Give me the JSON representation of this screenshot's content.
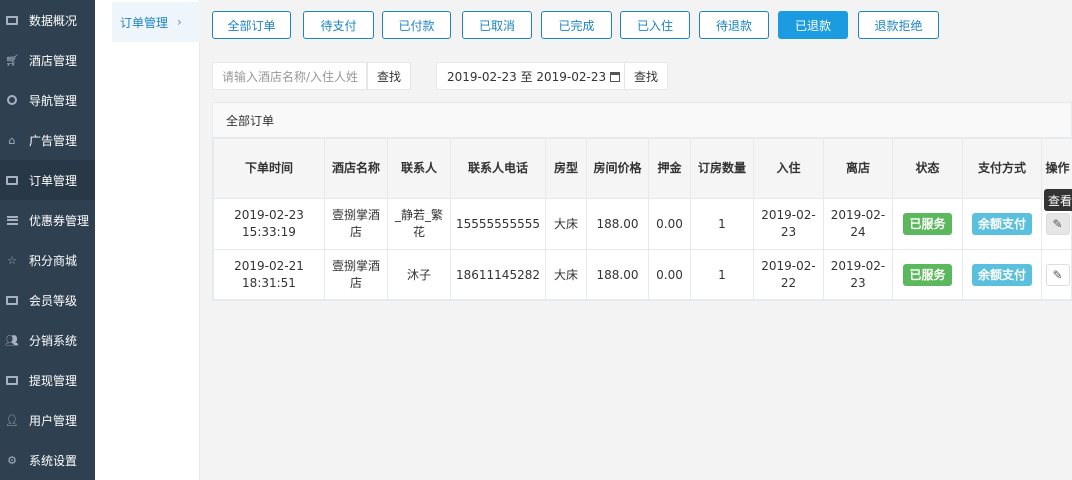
{
  "sidebar": {
    "items": [
      {
        "label": "数据概况",
        "icon": "dashboard-icon"
      },
      {
        "label": "酒店管理",
        "icon": "cart-icon"
      },
      {
        "label": "导航管理",
        "icon": "compass-icon"
      },
      {
        "label": "广告管理",
        "icon": "gift-icon"
      },
      {
        "label": "订单管理",
        "icon": "list-icon"
      },
      {
        "label": "优惠券管理",
        "icon": "bars-icon"
      },
      {
        "label": "积分商城",
        "icon": "star-icon"
      },
      {
        "label": "会员等级",
        "icon": "money-icon"
      },
      {
        "label": "分销系统",
        "icon": "users-icon"
      },
      {
        "label": "提现管理",
        "icon": "money-icon"
      },
      {
        "label": "用户管理",
        "icon": "user-icon"
      },
      {
        "label": "系统设置",
        "icon": "gear-icon"
      }
    ]
  },
  "submenu": {
    "label": "订单管理",
    "chevron": "›"
  },
  "status_tabs": [
    "全部订单",
    "待支付",
    "已付款",
    "已取消",
    "已完成",
    "已入住",
    "待退款",
    "已退款",
    "退款拒绝"
  ],
  "active_tab": "已退款",
  "search": {
    "placeholder": "请输入酒店名称/入住人姓",
    "button": "查找"
  },
  "date_filter": {
    "value": "2019-02-23 至 2019-02-23",
    "button": "查找"
  },
  "panel": {
    "title": "全部订单"
  },
  "table": {
    "headers": [
      "下单时间",
      "酒店名称",
      "联系人",
      "联系人电话",
      "房型",
      "房间价格",
      "押金",
      "订房数量",
      "入住",
      "离店",
      "状态",
      "支付方式",
      "操作"
    ],
    "rows": [
      {
        "time": "2019-02-23 15:33:19",
        "hotel": "壹捌掌酒店",
        "contact": "_静若_繁花",
        "phone": "15555555555",
        "room": "大床",
        "price": "188.00",
        "deposit": "0.00",
        "qty": "1",
        "checkin": "2019-02-23",
        "checkout": "2019-02-24",
        "status": "已服务",
        "payment": "余额支付"
      },
      {
        "time": "2019-02-21 18:31:51",
        "hotel": "壹捌掌酒店",
        "contact": "沐子",
        "phone": "18611145282",
        "room": "大床",
        "price": "188.00",
        "deposit": "0.00",
        "qty": "1",
        "checkin": "2019-02-22",
        "checkout": "2019-02-23",
        "status": "已服务",
        "payment": "余额支付"
      }
    ]
  },
  "tooltip": "查看",
  "colors": {
    "sidebar": "#2f4050",
    "accent": "#1c84c6",
    "active_tab": "#1c9ce0",
    "success": "#5cb85c",
    "info": "#5bc0de"
  }
}
